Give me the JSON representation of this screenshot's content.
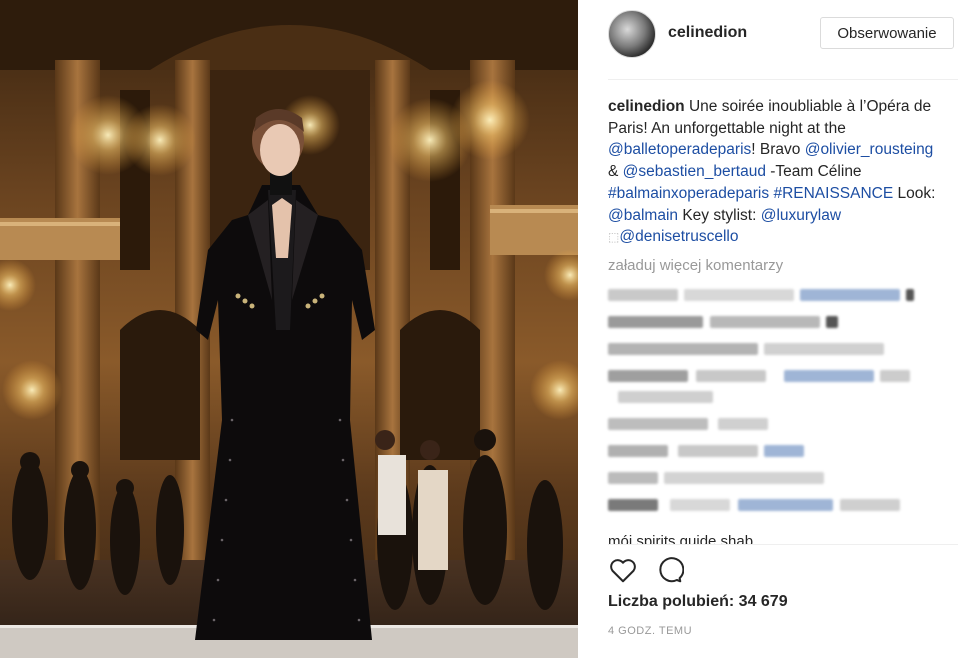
{
  "post": {
    "username": "celinedion",
    "follow_label": "Obserwowanie",
    "caption": {
      "username": "celinedion",
      "t1": " Une soirée inoubliable à l’Opéra de Paris! An unforgettable night at the ",
      "m1": "@balletoperadeparis",
      "t2": "! Bravo ",
      "m2": "@olivier_rousteing",
      "t3": " & ",
      "m3": "@sebastien_bertaud",
      "t4": " -Team Céline ",
      "m4": "#balmainxoperadeparis",
      "t5": " ",
      "m5": "#RENAISSANCE",
      "t6": " Look: ",
      "m6": "@balmain",
      "t7": " Key stylist: ",
      "m7": "@luxurylaw",
      "t8": " ",
      "t8b": "⬚",
      "m8": "@denisetruscello"
    },
    "load_more_label": "załaduj więcej komentarzy",
    "cut_comment_text": "mój spirits guide shab",
    "likes_label": "Liczba polubień: 34 679",
    "time_label": "4 GODZ. TEMU"
  },
  "colors": {
    "mention": "#1d4ea3",
    "muted": "#999999",
    "border": "#dbdbdb"
  },
  "icons": {
    "like": "heart-icon",
    "comment": "speech-bubble-icon"
  }
}
